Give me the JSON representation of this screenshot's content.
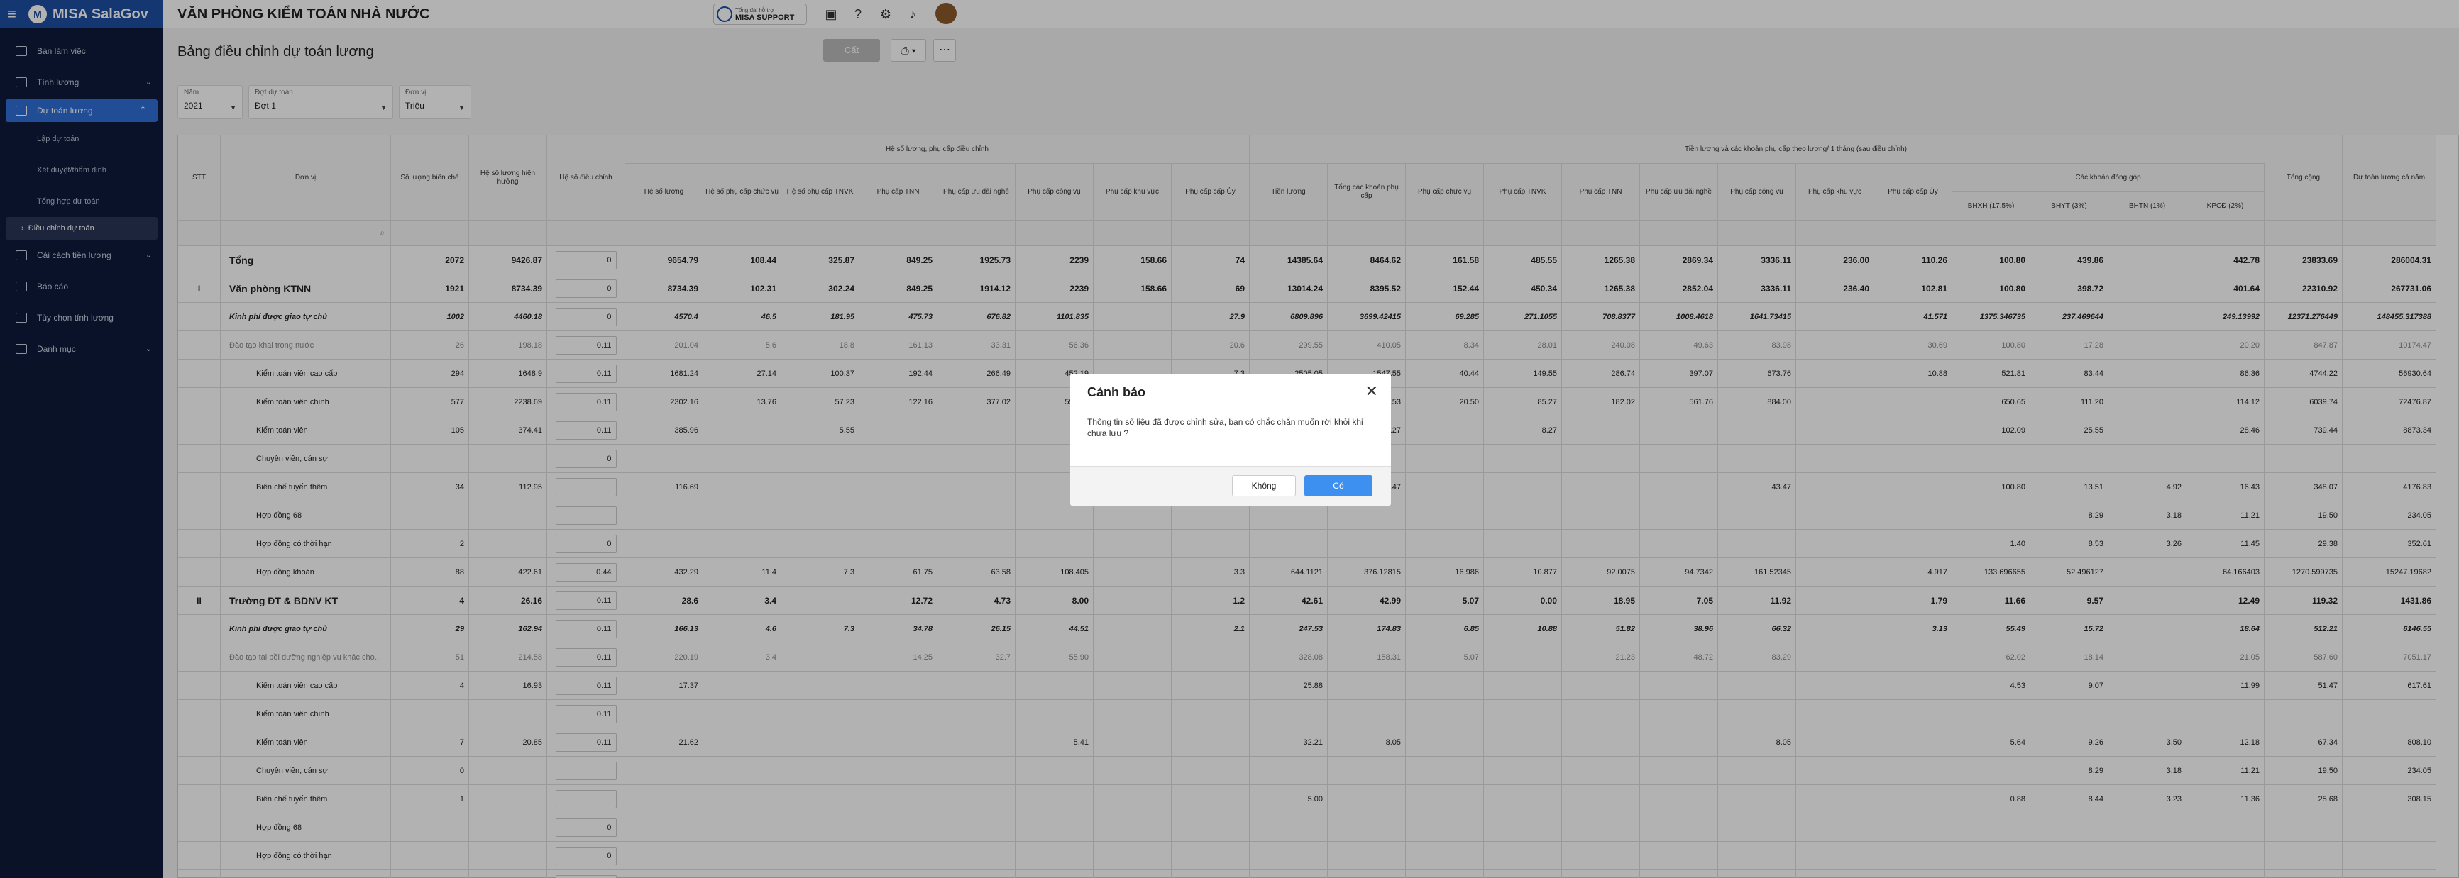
{
  "app": {
    "name": "MISA SalaGov",
    "org": "VĂN PHÒNG KIỂM TOÁN NHÀ NƯỚC",
    "support_small": "Tổng đài hỗ trợ",
    "support": "MISA SUPPORT"
  },
  "sidebar": {
    "items": [
      {
        "label": "Bàn làm việc"
      },
      {
        "label": "Tính lương",
        "chev": "⌄"
      },
      {
        "label": "Dự toán lương",
        "chev": "⌃",
        "active": true
      },
      {
        "label": "Cải cách tiền lương",
        "chev": "⌄"
      },
      {
        "label": "Báo cáo"
      },
      {
        "label": "Tùy chọn tính lương"
      },
      {
        "label": "Danh mục",
        "chev": "⌄"
      }
    ],
    "sub": [
      "Lập dự toán",
      "Xét duyệt/thẩm định",
      "Tổng hợp dự toán",
      "Điều chỉnh dự toán"
    ]
  },
  "page": {
    "title": "Bảng điều chỉnh dự toán lương",
    "save": "Cất"
  },
  "filters": [
    {
      "label": "Năm",
      "value": "2021"
    },
    {
      "label": "Đợt dự toán",
      "value": "Đợt 1"
    },
    {
      "label": "Đơn vị",
      "value": "Triệu"
    }
  ],
  "table": {
    "h_group1": "Hệ số lương, phụ cấp điều chỉnh",
    "h_group2": "Tiền lương và các khoản phụ cấp theo lương/ 1 tháng (sau điều chỉnh)",
    "h_group3": "Các khoản đóng góp",
    "heads": [
      "STT",
      "Đơn vị",
      "Số lượng biên chế",
      "Hệ số lương hiện hưởng",
      "Hệ số điều chỉnh",
      "Hệ số lương",
      "Hệ số phụ cấp chức vụ",
      "Hệ số phụ cấp TNVK",
      "Phụ cấp TNN",
      "Phụ cấp ưu đãi nghề",
      "Phụ cấp công vụ",
      "Phụ cấp khu vực",
      "Phụ cấp cấp Ủy",
      "Tiền lương",
      "Tổng các khoản phụ cấp",
      "Phụ cấp chức vụ",
      "Phụ cấp TNVK",
      "Phụ cấp TNN",
      "Phụ cấp ưu đãi nghề",
      "Phụ cấp công vụ",
      "Phụ cấp khu vực",
      "Phụ cấp cấp Ủy",
      "BHXH (17,5%)",
      "BHYT (3%)",
      "BHTN (1%)",
      "KPCĐ (2%)",
      "Tổng cộng",
      "Dự toán lương cả năm"
    ],
    "rows": [
      {
        "stt": "",
        "name": "Tổng",
        "b": true,
        "v": [
          "2072",
          "9426.87",
          "0",
          "9654.79",
          "108.44",
          "325.87",
          "849.25",
          "1925.73",
          "2239",
          "158.66",
          "74",
          "14385.64",
          "8464.62",
          "161.58",
          "485.55",
          "1265.38",
          "2869.34",
          "3336.11",
          "236.00",
          "110.26",
          "100.80",
          "439.86",
          "",
          "442.78",
          "23833.69",
          "286004.31"
        ]
      },
      {
        "stt": "I",
        "name": "Văn phòng KTNN",
        "b": true,
        "v": [
          "1921",
          "8734.39",
          "0",
          "8734.39",
          "102.31",
          "302.24",
          "849.25",
          "1914.12",
          "2239",
          "158.66",
          "69",
          "13014.24",
          "8395.52",
          "152.44",
          "450.34",
          "1265.38",
          "2852.04",
          "3336.11",
          "236.40",
          "102.81",
          "100.80",
          "398.72",
          "",
          "401.64",
          "22310.92",
          "267731.06"
        ]
      },
      {
        "stt": "",
        "name": "Kinh phí được giao tự chủ",
        "i": true,
        "v": [
          "1002",
          "4460.18",
          "0",
          "4570.4",
          "46.5",
          "181.95",
          "475.73",
          "676.82",
          "1101.835",
          "",
          "27.9",
          "6809.896",
          "3699.42415",
          "69.285",
          "271.1055",
          "708.8377",
          "1008.4618",
          "1641.73415",
          "",
          "41.571",
          "1375.346735",
          "237.469644",
          "",
          "249.13992",
          "12371.276449",
          "148455.317388"
        ]
      },
      {
        "stt": "",
        "name": "Đào tạo khai trong nước",
        "g": true,
        "v": [
          "26",
          "198.18",
          "0.11",
          "201.04",
          "5.6",
          "18.8",
          "161.13",
          "33.31",
          "56.36",
          "",
          "20.6",
          "299.55",
          "410.05",
          "8.34",
          "28.01",
          "240.08",
          "49.63",
          "83.98",
          "",
          "30.69",
          "100.80",
          "17.28",
          "",
          "20.20",
          "847.87",
          "10174.47"
        ]
      },
      {
        "stt": "",
        "name": "Kiểm toán viên cao cấp",
        "v": [
          "294",
          "1648.9",
          "0.11",
          "1681.24",
          "27.14",
          "100.37",
          "192.44",
          "266.49",
          "452.19",
          "",
          "7.3",
          "2505.05",
          "1547.55",
          "40.44",
          "149.55",
          "286.74",
          "397.07",
          "673.76",
          "",
          "10.88",
          "521.81",
          "83.44",
          "",
          "86.36",
          "4744.22",
          "56930.64"
        ]
      },
      {
        "stt": "",
        "name": "Kiểm toán viên chính",
        "v": [
          "577",
          "2238.69",
          "0.11",
          "2302.16",
          "13.76",
          "57.23",
          "122.16",
          "377.02",
          "593.29",
          "",
          "",
          "3430.22",
          "1733.53",
          "20.50",
          "85.27",
          "182.02",
          "561.76",
          "884.00",
          "",
          "",
          "650.65",
          "111.20",
          "",
          "114.12",
          "6039.74",
          "72476.87"
        ]
      },
      {
        "stt": "",
        "name": "Kiểm toán viên",
        "v": [
          "105",
          "374.41",
          "0.11",
          "385.96",
          "",
          "5.55",
          "",
          "",
          "",
          "",
          "",
          "",
          "8.27",
          "",
          "8.27",
          "",
          "",
          "",
          "",
          "",
          "102.09",
          "25.55",
          "",
          "28.46",
          "739.44",
          "8873.34"
        ]
      },
      {
        "stt": "",
        "name": "Chuyên viên, cán sự",
        "v": [
          "",
          "",
          "0",
          "",
          "",
          "",
          "",
          "",
          "",
          "",
          "",
          "",
          "",
          "",
          "",
          "",
          "",
          "",
          "",
          "",
          "",
          "",
          "",
          "",
          "",
          ""
        ]
      },
      {
        "stt": "",
        "name": "Biên chế tuyển thêm",
        "v": [
          "34",
          "112.95",
          "",
          "116.69",
          "",
          "",
          "",
          "",
          "",
          "",
          "",
          "",
          "43.47",
          "",
          "",
          "",
          "",
          "43.47",
          "",
          "",
          "100.80",
          "13.51",
          "4.92",
          "16.43",
          "348.07",
          "4176.83"
        ]
      },
      {
        "stt": "",
        "name": "Hợp đồng 68",
        "v": [
          "",
          "",
          "",
          "",
          "",
          "",
          "",
          "",
          "",
          "",
          "",
          "",
          "",
          "",
          "",
          "",
          "",
          "",
          "",
          "",
          "",
          "8.29",
          "3.18",
          "11.21",
          "19.50",
          "234.05"
        ]
      },
      {
        "stt": "",
        "name": "Hợp đồng có thời hạn",
        "v": [
          "2",
          "",
          "0",
          "",
          "",
          "",
          "",
          "",
          "",
          "",
          "",
          "",
          "",
          "",
          "",
          "",
          "",
          "",
          "",
          "",
          "1.40",
          "8.53",
          "3.26",
          "11.45",
          "29.38",
          "352.61"
        ]
      },
      {
        "stt": "",
        "name": "Hợp đồng khoán",
        "v": [
          "88",
          "422.61",
          "0.44",
          "432.29",
          "11.4",
          "7.3",
          "61.75",
          "63.58",
          "108.405",
          "",
          "3.3",
          "644.1121",
          "376.12815",
          "16.986",
          "10.877",
          "92.0075",
          "94.7342",
          "161.52345",
          "",
          "4.917",
          "133.696655",
          "52.496127",
          "",
          "64.166403",
          "1270.599735",
          "15247.19682"
        ]
      },
      {
        "stt": "II",
        "name": "Trường ĐT & BDNV KT",
        "b": true,
        "v": [
          "4",
          "26.16",
          "0.11",
          "28.6",
          "3.4",
          "",
          "12.72",
          "4.73",
          "8.00",
          "",
          "1.2",
          "42.61",
          "42.99",
          "5.07",
          "0.00",
          "18.95",
          "7.05",
          "11.92",
          "",
          "1.79",
          "11.66",
          "9.57",
          "",
          "12.49",
          "119.32",
          "1431.86"
        ]
      },
      {
        "stt": "",
        "name": "Kinh phí được giao tự chủ",
        "i": true,
        "v": [
          "29",
          "162.94",
          "0.11",
          "166.13",
          "4.6",
          "7.3",
          "34.78",
          "26.15",
          "44.51",
          "",
          "2.1",
          "247.53",
          "174.83",
          "6.85",
          "10.88",
          "51.82",
          "38.96",
          "66.32",
          "",
          "3.13",
          "55.49",
          "15.72",
          "",
          "18.64",
          "512.21",
          "6146.55"
        ]
      },
      {
        "stt": "",
        "name": "Đào tạo tại bồi dưỡng nghiệp vụ khác cho...",
        "g": true,
        "v": [
          "51",
          "214.58",
          "0.11",
          "220.19",
          "3.4",
          "",
          "14.25",
          "32.7",
          "55.90",
          "",
          "",
          "328.08",
          "158.31",
          "5.07",
          "",
          "21.23",
          "48.72",
          "83.29",
          "",
          "",
          "62.02",
          "18.14",
          "",
          "21.05",
          "587.60",
          "7051.17"
        ]
      },
      {
        "stt": "",
        "name": "Kiểm toán viên cao cấp",
        "v": [
          "4",
          "16.93",
          "0.11",
          "17.37",
          "",
          "",
          "",
          "",
          "",
          "",
          "",
          "25.88",
          "",
          "",
          "",
          "",
          "",
          "",
          "",
          "",
          "4.53",
          "9.07",
          "",
          "11.99",
          "51.47",
          "617.61"
        ]
      },
      {
        "stt": "",
        "name": "Kiểm toán viên chính",
        "v": [
          "",
          "",
          "0.11",
          "",
          "",
          "",
          "",
          "",
          "",
          "",
          "",
          "",
          "",
          "",
          "",
          "",
          "",
          "",
          "",
          "",
          "",
          "",
          "",
          "",
          "",
          ""
        ]
      },
      {
        "stt": "",
        "name": "Kiểm toán viên",
        "v": [
          "7",
          "20.85",
          "0.11",
          "21.62",
          "",
          "",
          "",
          "",
          "5.41",
          "",
          "",
          "32.21",
          "8.05",
          "",
          "",
          "",
          "",
          "8.05",
          "",
          "",
          "5.64",
          "9.26",
          "3.50",
          "12.18",
          "67.34",
          "808.10"
        ]
      },
      {
        "stt": "",
        "name": "Chuyên viên, cán sự",
        "v": [
          "0",
          "",
          "",
          "",
          "",
          "",
          "",
          "",
          "",
          "",
          "",
          "",
          "",
          "",
          "",
          "",
          "",
          "",
          "",
          "",
          "",
          "8.29",
          "3.18",
          "11.21",
          "19.50",
          "234.05"
        ]
      },
      {
        "stt": "",
        "name": "Biên chế tuyển thêm",
        "v": [
          "1",
          "",
          "",
          "",
          "",
          "",
          "",
          "",
          "",
          "",
          "",
          "5.00",
          "",
          "",
          "",
          "",
          "",
          "",
          "",
          "",
          "0.88",
          "8.44",
          "3.23",
          "11.36",
          "25.68",
          "308.15"
        ]
      },
      {
        "stt": "",
        "name": "Hợp đồng 68",
        "v": [
          "",
          "",
          "0",
          "",
          "",
          "",
          "",
          "",
          "",
          "",
          "",
          "",
          "",
          "",
          "",
          "",
          "",
          "",
          "",
          "",
          "",
          "",
          "",
          "",
          "",
          ""
        ]
      },
      {
        "stt": "",
        "name": "Hợp đồng có thời hạn",
        "v": [
          "",
          "",
          "0",
          "",
          "",
          "",
          "",
          "",
          "",
          "",
          "",
          "",
          "",
          "",
          "",
          "",
          "",
          "",
          "",
          "",
          "",
          "",
          "",
          "",
          "",
          ""
        ]
      },
      {
        "stt": "",
        "name": "Hợp đồng khoán",
        "v": [
          "",
          "",
          "0",
          "",
          "",
          "",
          "",
          "",
          "",
          "",
          "",
          "",
          "",
          "",
          "",
          "",
          "",
          "",
          "",
          "",
          "",
          "",
          "",
          "",
          "",
          ""
        ]
      }
    ]
  },
  "dialog": {
    "title": "Cảnh báo",
    "message": "Thông tin số liệu đã được chỉnh sửa, bạn có chắc chắn muốn rời khỏi khi chưa lưu ?",
    "no": "Không",
    "yes": "Có"
  },
  "colors": {
    "brand": "#1f4fa3",
    "active": "#2f6fd6",
    "primary_button": "#3d8ff0"
  },
  "icons": [
    "menu-icon",
    "chat-icon",
    "help-icon",
    "settings-icon",
    "bell-icon",
    "print-icon",
    "more-icon",
    "close-icon",
    "search-icon"
  ]
}
